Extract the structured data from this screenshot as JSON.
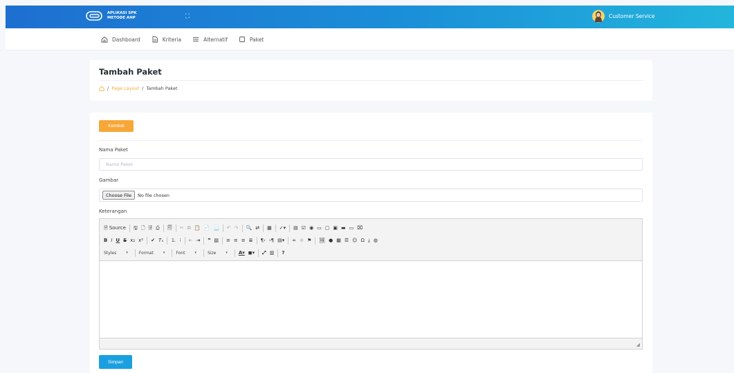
{
  "header": {
    "app_name_line1": "APLIKASI SPK",
    "app_name_line2": "METODE AHP",
    "user_name": "Customer Service"
  },
  "nav": {
    "items": [
      {
        "label": "Dashboard",
        "icon": "home-icon"
      },
      {
        "label": "Kriteria",
        "icon": "document-icon"
      },
      {
        "label": "Alternatif",
        "icon": "list-icon"
      },
      {
        "label": "Paket",
        "icon": "square-icon"
      }
    ]
  },
  "page": {
    "title": "Tambah Paket",
    "breadcrumb": {
      "home_icon": "home-icon",
      "link": "Page Layout",
      "separator": "/",
      "current": "Tambah Paket"
    }
  },
  "form": {
    "back_label": "Kembali",
    "nama_label": "Nama Paket",
    "nama_placeholder": "Nama Paket",
    "nama_value": "",
    "gambar_label": "Gambar",
    "file_button": "Choose File",
    "file_status": "No file chosen",
    "keterangan_label": "Keterangan",
    "save_label": "Simpan"
  },
  "editor": {
    "source_label": "Source",
    "combos": [
      "Styles",
      "Format",
      "Font",
      "Size"
    ],
    "help_label": "?"
  },
  "colors": {
    "header_gradient_start": "#1e6fd0",
    "header_gradient_end": "#23b5dc",
    "back_button": "#f7a737",
    "save_button": "#1aa0e0",
    "breadcrumb_link": "#f0a92e"
  }
}
